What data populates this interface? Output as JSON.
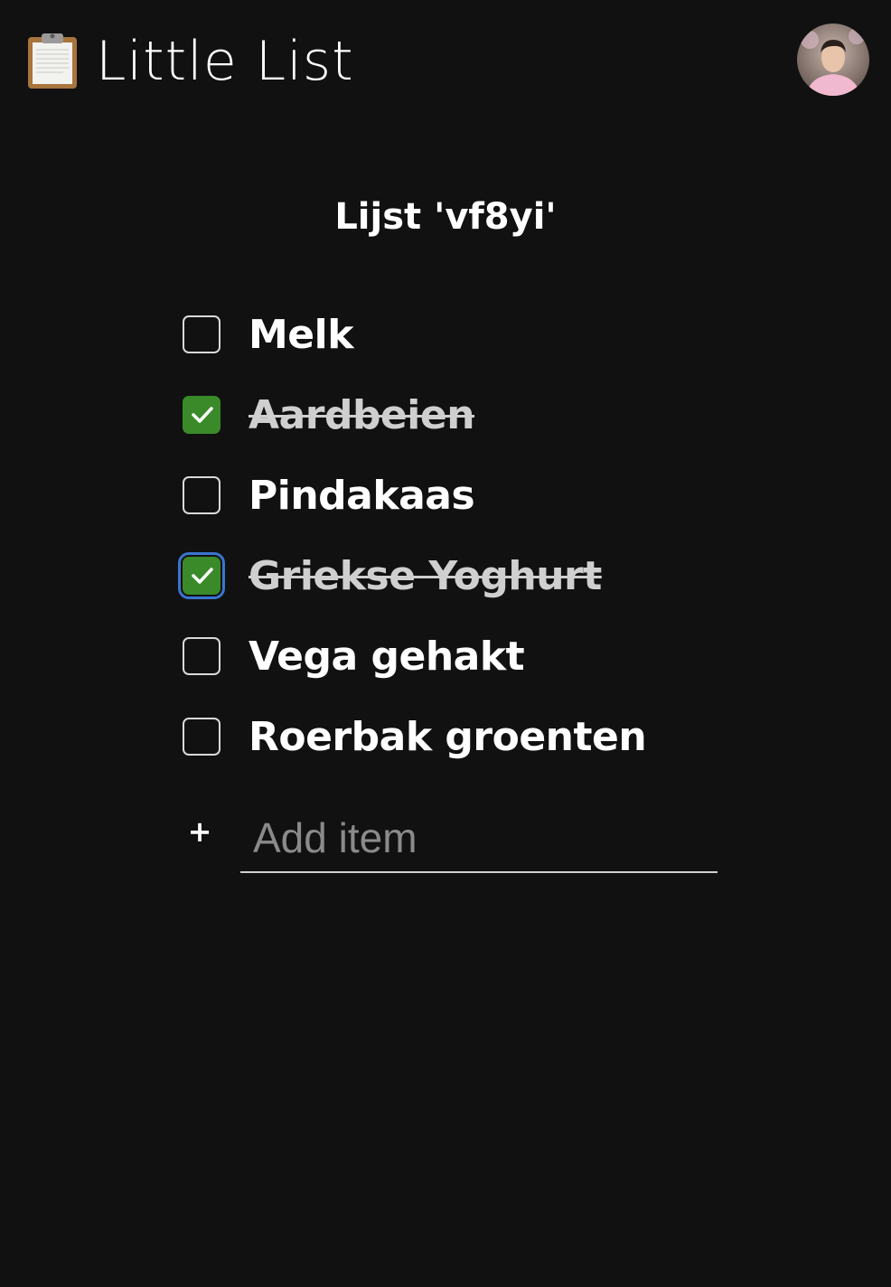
{
  "header": {
    "app_title": "Little List",
    "app_icon": "clipboard-icon",
    "avatar_icon": "user-avatar"
  },
  "list": {
    "title": "Lijst 'vf8yi'",
    "items": [
      {
        "label": "Melk",
        "checked": false
      },
      {
        "label": "Aardbeien",
        "checked": true
      },
      {
        "label": "Pindakaas",
        "checked": false
      },
      {
        "label": "Griekse Yoghurt",
        "checked": true,
        "focused": true
      },
      {
        "label": "Vega gehakt",
        "checked": false
      },
      {
        "label": "Roerbak groenten",
        "checked": false
      }
    ]
  },
  "add_item": {
    "plus_label": "+",
    "placeholder": "Add item",
    "value": ""
  },
  "colors": {
    "background": "#111111",
    "checked": "#3a8a2a",
    "focus_ring": "#3b74d0"
  }
}
